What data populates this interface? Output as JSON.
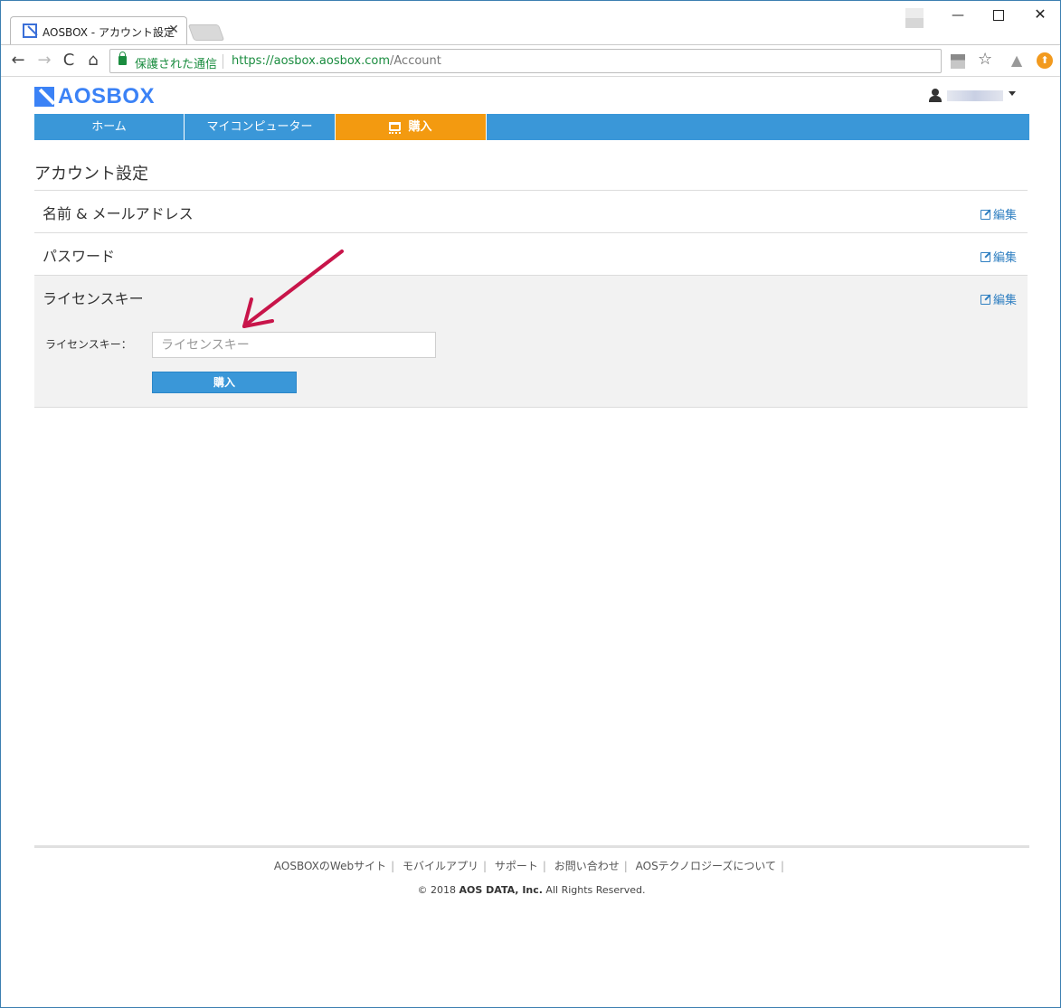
{
  "browser": {
    "tab_title": "AOSBOX - アカウント設定",
    "tab_close": "✕",
    "secure_label": "保護された通信",
    "url_host": "https://aosbox.aosbox.com",
    "url_path": "/Account",
    "win_min": "—",
    "win_close": "✕",
    "back_icon": "←",
    "forward_icon": "→",
    "reload_icon": "C",
    "home_icon": "⌂",
    "star_icon": "☆",
    "drive_icon": "▲",
    "update_icon": "⬆"
  },
  "site": {
    "logo_text": "AOSBOX",
    "nav": {
      "home": "ホーム",
      "mycomputer": "マイコンピューター",
      "buy": "購入"
    },
    "colors": {
      "nav": "#3a97d8",
      "nav_active": "#f39a10",
      "logo": "#3b82f6",
      "link": "#2f7fc1"
    }
  },
  "page": {
    "title": "アカウント設定",
    "sections": [
      {
        "title": "名前 & メールアドレス",
        "edit": "編集"
      },
      {
        "title": "パスワード",
        "edit": "編集"
      },
      {
        "title": "ライセンスキー",
        "edit": "編集"
      }
    ],
    "license_form": {
      "label": "ライセンスキー：",
      "placeholder": "ライセンスキー",
      "button": "購入"
    }
  },
  "footer": {
    "links": [
      "AOSBOXのWebサイト",
      "モバイルアプリ",
      "サポート",
      "お問い合わせ",
      "AOSテクノロジーズについて"
    ],
    "sep": "|",
    "copyright_prefix": "© 2018 ",
    "copyright_company": "AOS DATA, Inc.",
    "copyright_suffix": " All Rights Reserved."
  }
}
